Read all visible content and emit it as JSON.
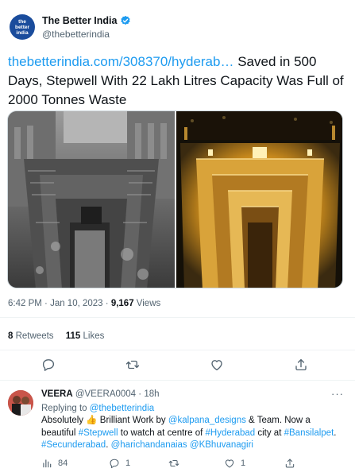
{
  "account": {
    "name": "The Better India",
    "handle": "@thebetterindia",
    "avatar_text": [
      "the",
      "better",
      "india"
    ]
  },
  "tweet": {
    "link_text": "thebetterindia.com/308370/hyderab…",
    "text": " Saved in 500 Days, Stepwell With 22 Lakh Litres Capacity Was Full of 2000 Tonnes Waste",
    "time": "6:42 PM",
    "separator": " · ",
    "date": "Jan 10, 2023",
    "views_count": "9,167",
    "views_label": " Views",
    "retweets_count": "8",
    "retweets_label": " Retweets",
    "likes_count": "115",
    "likes_label": " Likes"
  },
  "actions": {
    "icons": [
      "reply-icon",
      "retweet-icon",
      "like-icon",
      "share-icon"
    ]
  },
  "reply": {
    "name": "VEERA",
    "handle": "@VEERA0004",
    "separator": " · ",
    "age": "18h",
    "replying_prefix": "Replying to ",
    "replying_to": "@thebetterindia",
    "segments": [
      {
        "t": "Absolutely ",
        "link": false
      },
      {
        "t": "👍",
        "link": false
      },
      {
        "t": " Brilliant Work by ",
        "link": false
      },
      {
        "t": "@kalpana_designs",
        "link": true
      },
      {
        "t": " & Team. Now a beautiful ",
        "link": false
      },
      {
        "t": "#Stepwell",
        "link": true
      },
      {
        "t": " to watch at centre of ",
        "link": false
      },
      {
        "t": "#Hyderabad",
        "link": true
      },
      {
        "t": " city at ",
        "link": false
      },
      {
        "t": "#Bansilalpet",
        "link": true
      },
      {
        "t": ". ",
        "link": false
      },
      {
        "t": "#Secunderabad",
        "link": true
      },
      {
        "t": ". ",
        "link": false
      },
      {
        "t": "@harichandanaias",
        "link": true
      },
      {
        "t": " ",
        "link": false
      },
      {
        "t": "@KBhuvanagiri",
        "link": true
      }
    ],
    "views": "84",
    "replies": "1",
    "likes": "1"
  },
  "colors": {
    "link": "#1d9bf0",
    "secondary_text": "#536471",
    "verified": "#1d9bf0",
    "brand_avatar": "#1a4c9c"
  }
}
